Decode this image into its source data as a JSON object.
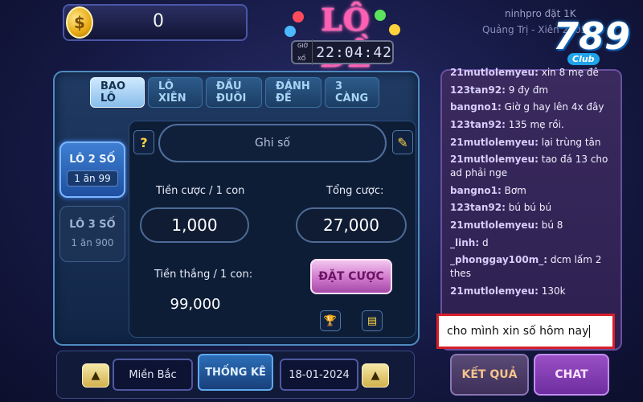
{
  "header": {
    "coin_value": "0",
    "logo_text": "LÔ ĐỀ",
    "timer_label": "GIỜ XỔ",
    "timer_value": "22:04:42",
    "ticker_line1": "ninhpro đặt 1K",
    "ticker_line2": "Quảng Trị - Xiên 2: 05",
    "brand_number": "789",
    "brand_club": "Club"
  },
  "tabs": [
    {
      "label": "BAO LÔ",
      "active": true
    },
    {
      "label": "LÔ XIÊN",
      "active": false
    },
    {
      "label": "ĐẦU ĐUÔI",
      "active": false
    },
    {
      "label": "ĐÁNH ĐỀ",
      "active": false
    },
    {
      "label": "3 CÀNG",
      "active": false
    }
  ],
  "options": [
    {
      "title": "LÔ 2 SỐ",
      "rate": "1 ăn 99"
    },
    {
      "title": "LÔ 3 SỐ",
      "rate": "1 ăn 900"
    }
  ],
  "form": {
    "note_placeholder": "Ghi số",
    "bet_label": "Tiền cược / 1 con",
    "bet_value": "1,000",
    "total_label": "Tổng cược:",
    "total_value": "27,000",
    "win_label": "Tiền thắng / 1 con:",
    "win_value": "99,000",
    "bet_button": "ĐẶT CƯỢC"
  },
  "bottom": {
    "region": "Miền Bắc",
    "stats_button": "THỐNG KÊ",
    "date": "18-01-2024"
  },
  "chat": {
    "messages": [
      {
        "user": "21mutlolemyeu:",
        "text": "xin 8 mẹ đê"
      },
      {
        "user": "123tan92:",
        "text": "9 đy đm"
      },
      {
        "user": "bangno1:",
        "text": "Giờ g hay lên 4x đây"
      },
      {
        "user": "123tan92:",
        "text": "135 mẹ rồi."
      },
      {
        "user": "21mutlolemyeu:",
        "text": "lại trùng tân"
      },
      {
        "user": "21mutlolemyeu:",
        "text": "tao đá 13 cho ad phải nge"
      },
      {
        "user": "bangno1:",
        "text": "Bơm"
      },
      {
        "user": "123tan92:",
        "text": "bú bú bú"
      },
      {
        "user": "21mutlolemyeu:",
        "text": "bú 8"
      },
      {
        "user": "_linh:",
        "text": "d"
      },
      {
        "user": "_phonggay100m_:",
        "text": "dcm lấm 2 thes"
      },
      {
        "user": "21mutlolemyeu:",
        "text": "130k"
      }
    ],
    "input_value": "cho mình xin số hôm nay",
    "result_button": "KẾT QUẢ",
    "chat_button": "CHAT"
  },
  "colors": {
    "accent_pink": "#ff5fb3",
    "tab_active": "#cfe9ff",
    "chat_highlight": "#d61f2a"
  }
}
